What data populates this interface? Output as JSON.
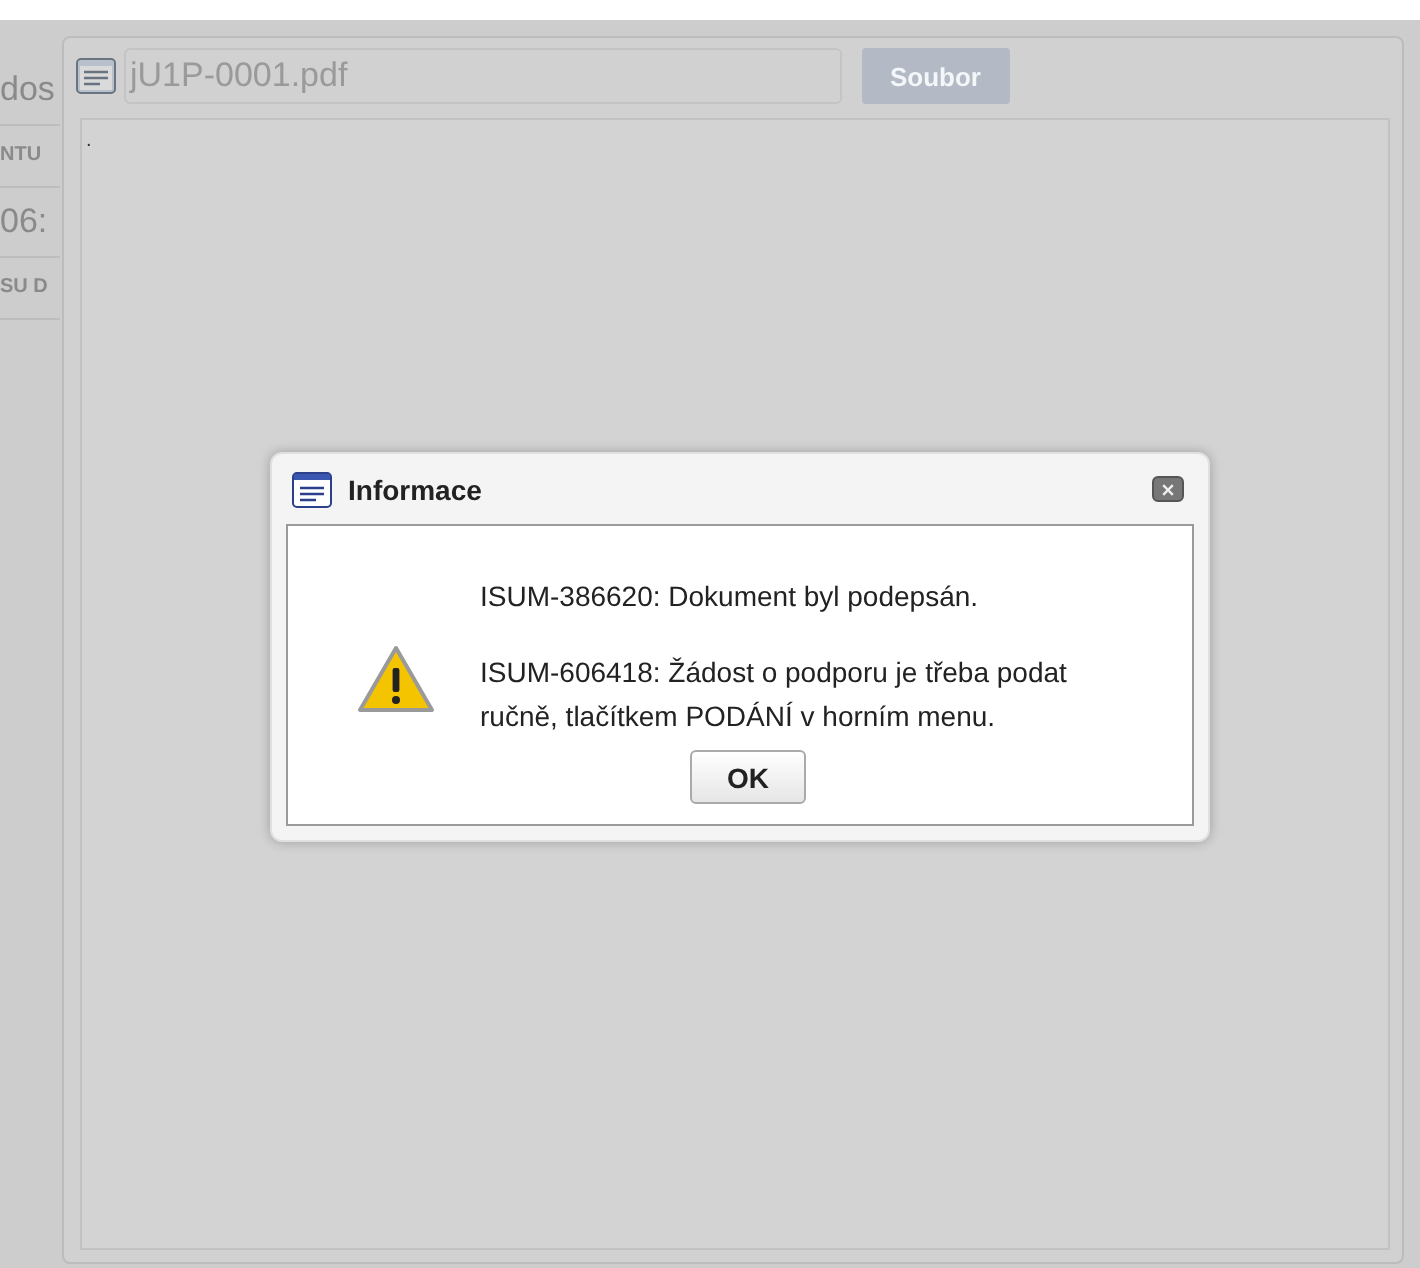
{
  "background_page": {
    "fragments": [
      "dos",
      "NTU",
      "06:",
      "SU D"
    ]
  },
  "document_window": {
    "title": "jU1P-0001.pdf",
    "button": "Soubor",
    "body_mark": "."
  },
  "dialog": {
    "title": "Informace",
    "messages": [
      "ISUM-386620: Dokument byl podepsán.",
      "ISUM-606418: Žádost o podporu je třeba podat ručně, tlačítkem PODÁNÍ v horním menu."
    ],
    "buttons": [
      "OK"
    ]
  }
}
